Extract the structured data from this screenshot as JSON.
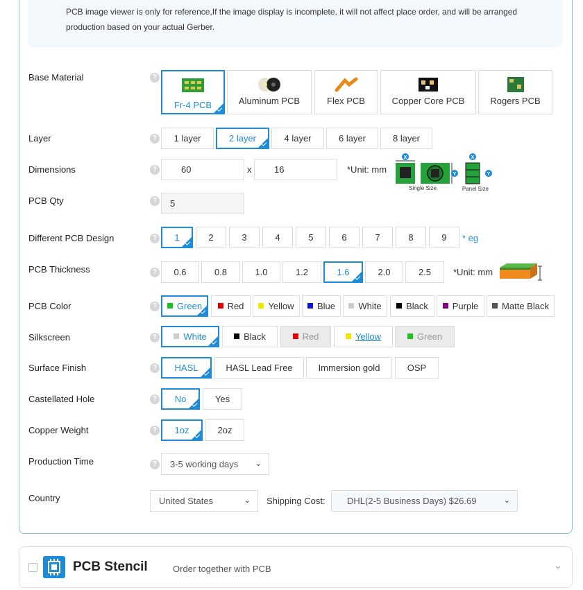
{
  "notice": {
    "line1": "PCB image viewer is only for reference,If the image display is incomplete, it will not affect place order, and will be arranged",
    "line2": "production based on your actual Gerber."
  },
  "help_glyph": "?",
  "base_material": {
    "label": "Base Material",
    "options": [
      "Fr-4 PCB",
      "Aluminum PCB",
      "Flex PCB",
      "Copper Core PCB",
      "Rogers PCB"
    ],
    "selected": "Fr-4 PCB"
  },
  "layer": {
    "label": "Layer",
    "options": [
      "1 layer",
      "2 layer",
      "4 layer",
      "6 layer",
      "8 layer"
    ],
    "selected": "2 layer"
  },
  "dimensions": {
    "label": "Dimensions",
    "width": "60",
    "x_sep": "x",
    "height": "16",
    "unit": "*Unit: mm",
    "single_size": "Single Size",
    "panel_size": "Panel Size",
    "axis_x": "X",
    "axis_y": "Y"
  },
  "pcb_qty": {
    "label": "PCB Qty",
    "value": "5"
  },
  "different_design": {
    "label": "Different PCB Design",
    "options": [
      "1",
      "2",
      "3",
      "4",
      "5",
      "6",
      "7",
      "8",
      "9"
    ],
    "selected": "1",
    "hint": "* eg"
  },
  "thickness": {
    "label": "PCB Thickness",
    "options": [
      "0.6",
      "0.8",
      "1.0",
      "1.2",
      "1.6",
      "2.0",
      "2.5"
    ],
    "selected": "1.6",
    "unit": "*Unit: mm"
  },
  "pcb_color": {
    "label": "PCB Color",
    "options": [
      {
        "name": "Green",
        "color": "#1ec41e"
      },
      {
        "name": "Red",
        "color": "#e30000"
      },
      {
        "name": "Yellow",
        "color": "#f2e600"
      },
      {
        "name": "Blue",
        "color": "#1010e0"
      },
      {
        "name": "White",
        "color": "#cccccc"
      },
      {
        "name": "Black",
        "color": "#000000"
      },
      {
        "name": "Purple",
        "color": "#800080"
      },
      {
        "name": "Matte Black",
        "color": "#555555"
      }
    ],
    "selected": "Green"
  },
  "silkscreen": {
    "label": "Silkscreen",
    "options": [
      {
        "name": "White",
        "color": "#cccccc"
      },
      {
        "name": "Black",
        "color": "#000000"
      },
      {
        "name": "Red",
        "color": "#e30000"
      },
      {
        "name": "Yellow",
        "color": "#f2e600"
      },
      {
        "name": "Green",
        "color": "#1ec41e"
      }
    ],
    "selected": "White"
  },
  "surface_finish": {
    "label": "Surface Finish",
    "options": [
      "HASL",
      "HASL Lead Free",
      "Immersion gold",
      "OSP"
    ],
    "selected": "HASL"
  },
  "castellated": {
    "label": "Castellated Hole",
    "options": [
      "No",
      "Yes"
    ],
    "selected": "No"
  },
  "copper_weight": {
    "label": "Copper Weight",
    "options": [
      "1oz",
      "2oz"
    ],
    "selected": "1oz"
  },
  "production_time": {
    "label": "Production Time",
    "value": "3-5 working days"
  },
  "country": {
    "label": "Country",
    "value": "United States",
    "shipping_label": "Shipping Cost:",
    "shipping_value": "DHL(2-5 Business Days) $26.69"
  },
  "stencil": {
    "title": "PCB Stencil",
    "subtitle": "Order together with PCB"
  },
  "accent_color": "#1d8bd8"
}
